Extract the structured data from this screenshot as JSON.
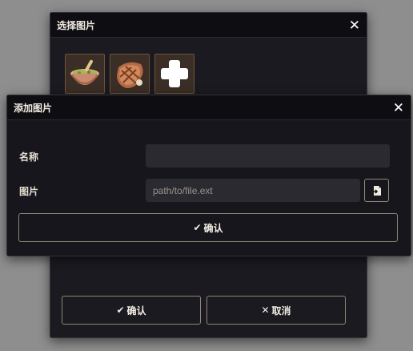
{
  "select_dialog": {
    "title": "选择图片",
    "close_glyph": "✕",
    "thumbnails": [
      {
        "name": "soup-bowl-icon"
      },
      {
        "name": "grilled-steak-icon"
      },
      {
        "name": "plus-icon"
      }
    ],
    "confirm_label": "确认",
    "cancel_label": "取消"
  },
  "add_dialog": {
    "title": "添加图片",
    "close_glyph": "✕",
    "name_label": "名称",
    "name_value": "",
    "image_label": "图片",
    "image_placeholder": "path/to/file.ext",
    "confirm_label": "确认"
  },
  "colors": {
    "backdrop": "#8e8e8e",
    "dialog_bg": "#1c1a21",
    "header_bg": "#0e0d12",
    "input_bg": "#2c2a31",
    "button_border": "#8f8675",
    "thumb_border": "#6a5638"
  }
}
